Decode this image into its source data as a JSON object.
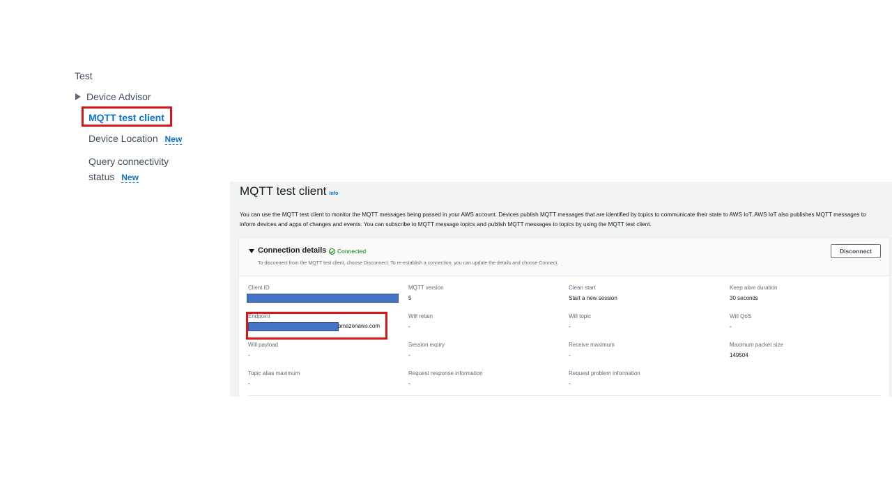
{
  "nav": {
    "section": "Test",
    "items": [
      {
        "label": "Device Advisor"
      },
      {
        "label": "MQTT test client"
      },
      {
        "label": "Device Location",
        "badge": "New"
      },
      {
        "label": "Query connectivity status",
        "badge": "New"
      }
    ]
  },
  "page": {
    "title": "MQTT test client",
    "info": "Info",
    "description": "You can use the MQTT test client to monitor the MQTT messages being passed in your AWS account. Devices publish MQTT messages that are identified by topics to communicate their state to AWS IoT. AWS IoT also publishes MQTT messages to inform devices and apps of changes and events. You can subscribe to MQTT message topics and publish MQTT messages to topics by using the MQTT test client."
  },
  "connection": {
    "title": "Connection details",
    "status": "Connected",
    "subtitle": "To disconnect from the MQTT test client, choose Disconnect. To re-establish a connection, you can update the details and choose Connect.",
    "disconnect_label": "Disconnect",
    "fields": [
      {
        "label": "Client ID",
        "value": ""
      },
      {
        "label": "MQTT version",
        "value": "5"
      },
      {
        "label": "Clean start",
        "value": "Start a new session"
      },
      {
        "label": "Keep alive duration",
        "value": "30 seconds"
      },
      {
        "label": "Endpoint",
        "value": "amazonaws.com"
      },
      {
        "label": "Will retain",
        "value": "-"
      },
      {
        "label": "Will topic",
        "value": "-"
      },
      {
        "label": "Will QoS",
        "value": "-"
      },
      {
        "label": "Will payload",
        "value": "-"
      },
      {
        "label": "Session expiry",
        "value": "-"
      },
      {
        "label": "Receive maximum",
        "value": "-"
      },
      {
        "label": "Maximum packet size",
        "value": "149504"
      },
      {
        "label": "Topic alias maximum",
        "value": "-"
      },
      {
        "label": "Request response information",
        "value": "-"
      },
      {
        "label": "Request problem information",
        "value": "-"
      }
    ]
  },
  "colors": {
    "highlight": "#d91515",
    "link": "#0972d3",
    "success": "#037f0c",
    "redaction": "#4472c4"
  }
}
